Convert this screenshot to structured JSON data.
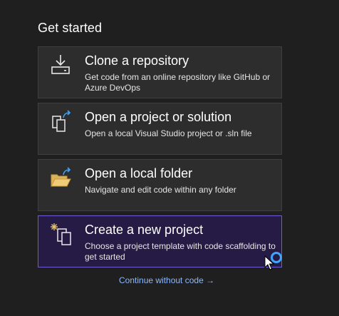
{
  "header": {
    "title": "Get started"
  },
  "cards": [
    {
      "title": "Clone a repository",
      "description": "Get code from an online repository like GitHub or Azure DevOps",
      "icon": "clone-download-icon"
    },
    {
      "title": "Open a project or solution",
      "description": "Open a local Visual Studio project or .sln file",
      "icon": "open-project-icon"
    },
    {
      "title": "Open a local folder",
      "description": "Navigate and edit code within any folder",
      "icon": "open-folder-icon"
    },
    {
      "title": "Create a new project",
      "description": "Choose a project template with code scaffolding to get started",
      "icon": "new-project-icon",
      "selected": true
    }
  ],
  "footer": {
    "continue_label": "Continue without code →"
  },
  "colors": {
    "background": "#1f1f1f",
    "card": "#2d2d2d",
    "selected_card": "#261b45",
    "selected_border": "#6f5bd6",
    "link": "#8bb8ff",
    "busy_indicator": "#3ea6ff",
    "folder_icon": "#e8c26b"
  }
}
